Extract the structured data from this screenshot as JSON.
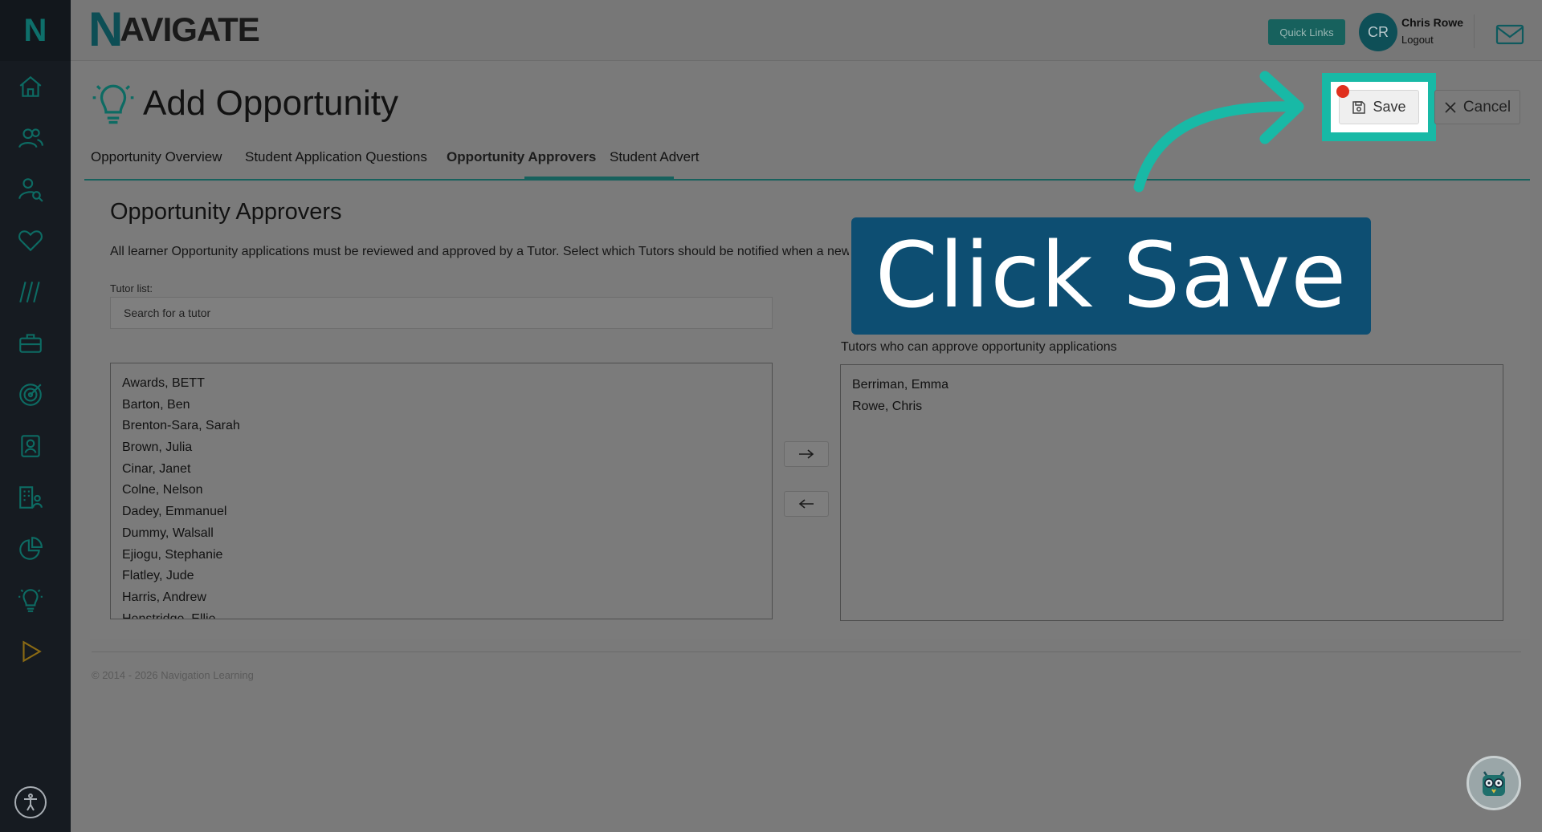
{
  "brand": {
    "initial": "N",
    "rest": "AVIGATE"
  },
  "header": {
    "quick_links": "Quick Links",
    "avatar_initials": "CR",
    "user_name": "Chris Rowe",
    "logout": "Logout"
  },
  "sidebar": {
    "logo": "N",
    "items": [
      "home-icon",
      "users-icon",
      "user-search-icon",
      "heart-icon",
      "slashes-icon",
      "briefcase-icon",
      "target-icon",
      "contact-card-icon",
      "building-people-icon",
      "pie-chart-icon",
      "lightbulb-icon",
      "play-icon"
    ]
  },
  "page": {
    "title": "Add Opportunity",
    "save_label": "Save",
    "cancel_label": "Cancel"
  },
  "tabs": [
    {
      "label": "Opportunity Overview"
    },
    {
      "label": "Student Application Questions"
    },
    {
      "label": "Opportunity Approvers"
    },
    {
      "label": "Student Advert"
    }
  ],
  "section": {
    "title": "Opportunity Approvers",
    "description": "All learner Opportunity applications must be reviewed and approved by a Tutor. Select which Tutors should be notified when a new",
    "tutor_list_label": "Tutor list:",
    "search_placeholder": "Search for a tutor",
    "right_label": "Tutors who can approve opportunity applications"
  },
  "tutors": [
    "Awards, BETT",
    "Barton, Ben",
    "Brenton-Sara, Sarah",
    "Brown, Julia",
    "Cinar, Janet",
    "Colne, Nelson",
    "Dadey, Emmanuel",
    "Dummy, Walsall",
    "Ejiogu, Stephanie",
    "Flatley, Jude",
    "Harris, Andrew",
    "Henstridge, Ellie"
  ],
  "approvers": [
    "Berriman, Emma",
    "Rowe, Chris"
  ],
  "overlay": {
    "text": "Click Save"
  },
  "footer": {
    "copyright": "© 2014 - 2026 Navigation Learning"
  }
}
